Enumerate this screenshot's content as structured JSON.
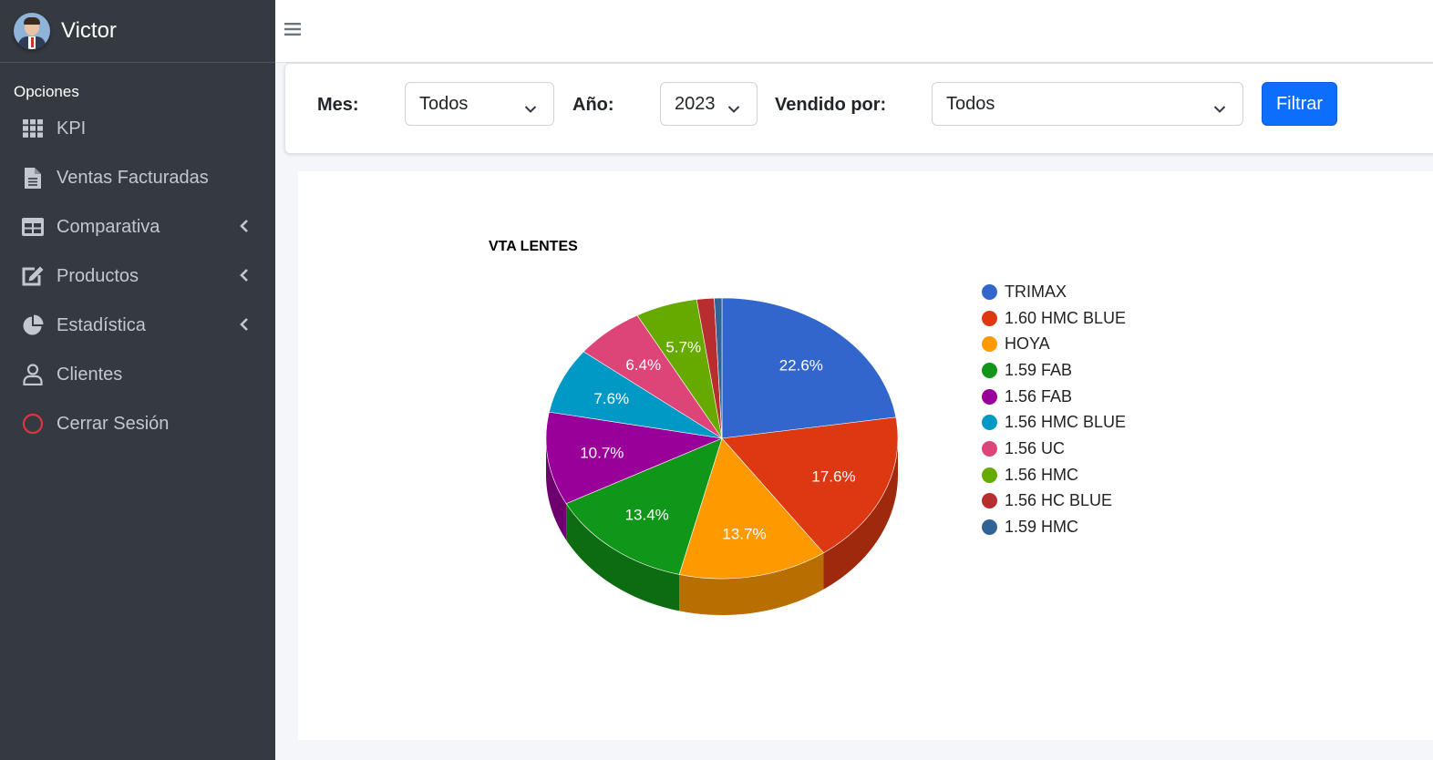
{
  "user": {
    "name": "Victor"
  },
  "sidebar": {
    "section": "Opciones",
    "items": [
      {
        "label": "KPI",
        "icon": "grid-icon"
      },
      {
        "label": "Ventas Facturadas",
        "icon": "document-icon"
      },
      {
        "label": "Comparativa",
        "icon": "table-icon",
        "expandable": true
      },
      {
        "label": "Productos",
        "icon": "edit-icon",
        "expandable": true
      },
      {
        "label": "Estadística",
        "icon": "pie-chart-icon",
        "expandable": true
      },
      {
        "label": "Clientes",
        "icon": "user-icon"
      },
      {
        "label": "Cerrar Sesión",
        "icon": "logout-circle-icon"
      }
    ]
  },
  "filters": {
    "month_label": "Mes:",
    "month_value": "Todos",
    "year_label": "Año:",
    "year_value": "2023",
    "seller_label": "Vendido por:",
    "seller_value": "Todos",
    "button": "Filtrar"
  },
  "colors": {
    "sidebar_bg": "#343a40",
    "primary": "#0d6efd",
    "logout_icon": "#dc3545"
  },
  "chart_data": {
    "type": "pie",
    "title": "VTA LENTES",
    "is3D": true,
    "legend_position": "right",
    "slices": [
      {
        "label": "TRIMAX",
        "percent": 22.6,
        "color": "#3366cc"
      },
      {
        "label": "1.60 HMC BLUE",
        "percent": 17.6,
        "color": "#dc3912"
      },
      {
        "label": "HOYA",
        "percent": 13.7,
        "color": "#ff9900"
      },
      {
        "label": "1.59 FAB",
        "percent": 13.4,
        "color": "#109618"
      },
      {
        "label": "1.56 FAB",
        "percent": 10.7,
        "color": "#990099"
      },
      {
        "label": "1.56 HMC BLUE",
        "percent": 7.6,
        "color": "#0099c6"
      },
      {
        "label": "1.56 UC",
        "percent": 6.4,
        "color": "#dd4477"
      },
      {
        "label": "1.56 HMC",
        "percent": 5.7,
        "color": "#66aa00"
      },
      {
        "label": "1.56 HC BLUE",
        "percent": 1.6,
        "color": "#b82e2e"
      },
      {
        "label": "1.59 HMC",
        "percent": 0.7,
        "color": "#316395"
      }
    ]
  }
}
